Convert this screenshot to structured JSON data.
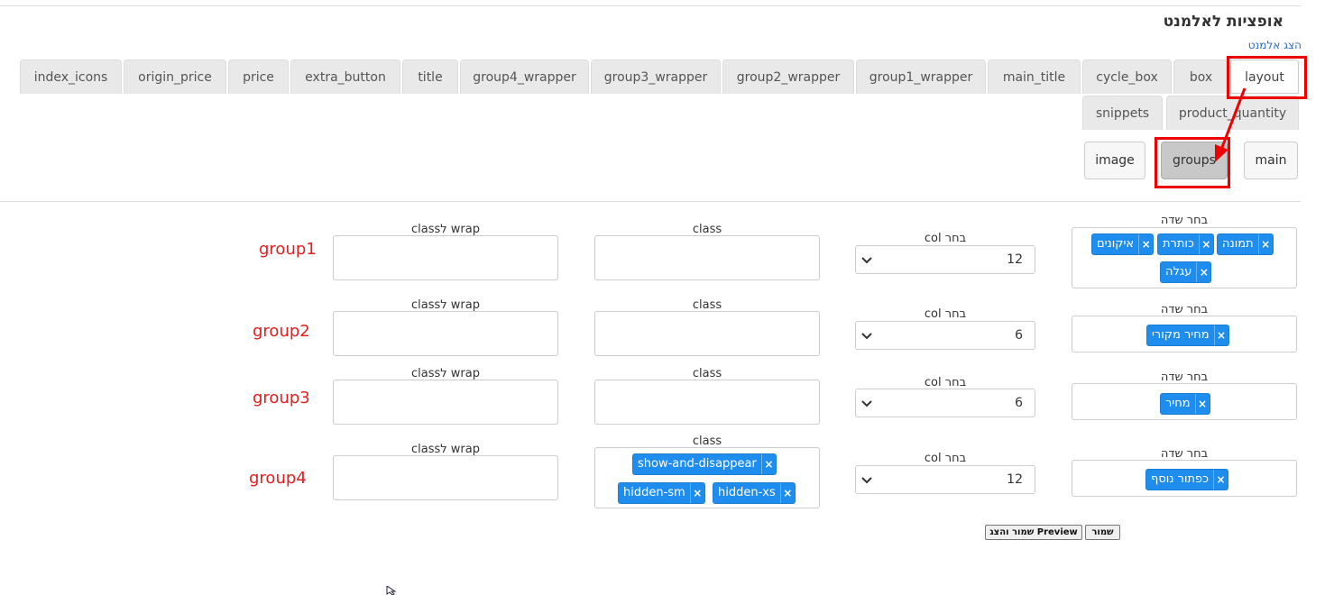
{
  "header": {
    "title": "אופציות לאלמנט",
    "show_link": "הצג אלמנט"
  },
  "tabs_row1": [
    "index_icons",
    "origin_price",
    "price",
    "extra_button",
    "title",
    "group4_wrapper",
    "group3_wrapper",
    "group2_wrapper",
    "group1_wrapper",
    "main_title",
    "cycle_box",
    "box",
    "layout"
  ],
  "tabs_row2": [
    "snippets",
    "product_quantity"
  ],
  "subtabs": [
    "image",
    "groups",
    "main"
  ],
  "active_tab": "layout",
  "active_subtab": "groups",
  "labels": {
    "field": "בחר שדה",
    "col": "בחר col",
    "class": "class",
    "wrap_class": "wrap לclass"
  },
  "groups": [
    {
      "name": "group1",
      "col": "12",
      "field_tags": [
        "תמונה",
        "כותרת",
        "איקונים",
        "עגלה"
      ],
      "class_tags": [],
      "wrap_class": ""
    },
    {
      "name": "group2",
      "col": "6",
      "field_tags": [
        "מחיר מקורי"
      ],
      "class_tags": [],
      "wrap_class": ""
    },
    {
      "name": "group3",
      "col": "6",
      "field_tags": [
        "מחיר"
      ],
      "class_tags": [],
      "wrap_class": ""
    },
    {
      "name": "group4",
      "col": "12",
      "field_tags": [
        "כפתור נוסף"
      ],
      "class_tags": [
        "show-and-disappear",
        "hidden-sm",
        "hidden-xs"
      ],
      "wrap_class": ""
    }
  ],
  "buttons": {
    "save": "שמור",
    "save_preview": "שמור והצג Preview"
  },
  "colors": {
    "accent_tag": "#1f8ded",
    "highlight": "#ee0000",
    "group_label": "#e02020"
  }
}
